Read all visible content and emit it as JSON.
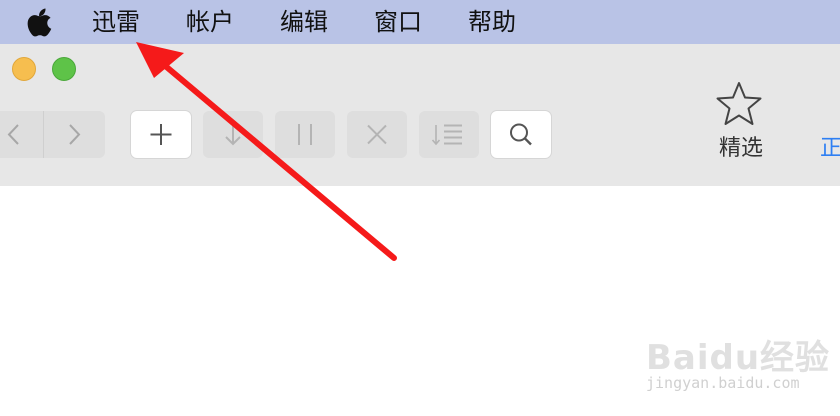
{
  "menubar": {
    "items": [
      "迅雷",
      "帐户",
      "编辑",
      "窗口",
      "帮助"
    ]
  },
  "toolbar": {
    "featured_label": "精选",
    "truncated_tab_label": "正"
  },
  "watermark": {
    "main": "Baidu经验",
    "sub": "jingyan.baidu.com"
  },
  "colors": {
    "menubar_bg": "#b9c3e6",
    "toolbar_bg": "#e7e7e7",
    "annotation_arrow": "#f51a1a",
    "accent_blue": "#2e7ff3"
  }
}
